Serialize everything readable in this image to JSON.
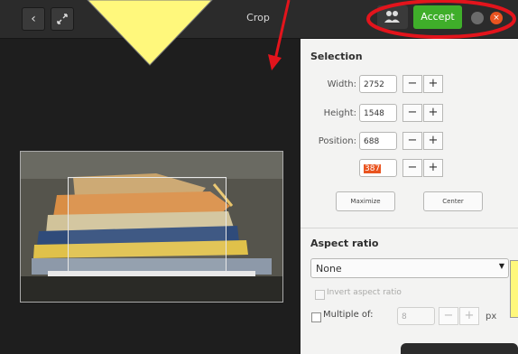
{
  "header": {
    "title": "Crop",
    "accept_label": "Accept"
  },
  "selection": {
    "title": "Selection",
    "width_label": "Width:",
    "width_value": "2752",
    "height_label": "Height:",
    "height_value": "1548",
    "position_label": "Position:",
    "position_x": "688",
    "position_y": "387",
    "minus": "−",
    "plus": "+",
    "maximize_label": "Maximize",
    "center_label": "Center"
  },
  "aspect": {
    "title": "Aspect ratio",
    "selected": "None",
    "invert_label": "Invert aspect ratio",
    "multiple_label": "Multiple of:",
    "multiple_value": "8",
    "unit": "px"
  },
  "colors": {
    "accept": "#3fae2a",
    "annotation": "#e3141c",
    "callout": "#fff87c"
  },
  "icons": [
    "back-arrow-icon",
    "fullscreen-icon",
    "people-icon",
    "settings-icon",
    "close-icon",
    "dropdown-arrow-icon"
  ]
}
